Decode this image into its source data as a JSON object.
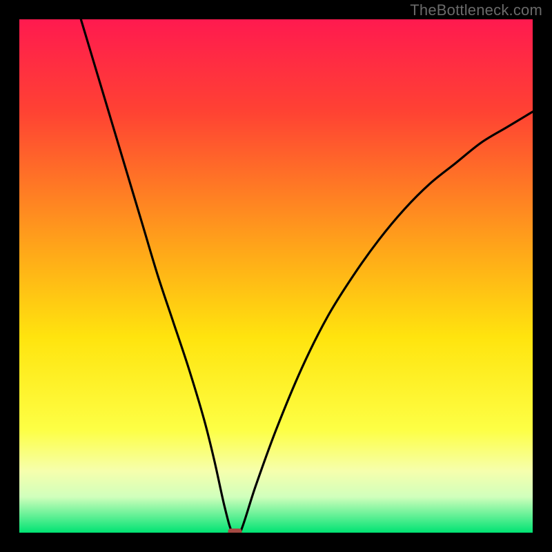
{
  "watermark": "TheBottleneck.com",
  "chart_data": {
    "type": "line",
    "title": "",
    "xlabel": "",
    "ylabel": "",
    "xlim": [
      0,
      100
    ],
    "ylim": [
      0,
      100
    ],
    "grid": false,
    "legend": false,
    "annotations": [],
    "marker": {
      "x": 42,
      "y": 0,
      "color": "#a54a43"
    },
    "gradient_stops": [
      {
        "offset": 0,
        "color": "#ff1a4f"
      },
      {
        "offset": 18,
        "color": "#ff4233"
      },
      {
        "offset": 45,
        "color": "#ffa719"
      },
      {
        "offset": 62,
        "color": "#ffe40e"
      },
      {
        "offset": 80,
        "color": "#fdff45"
      },
      {
        "offset": 88,
        "color": "#f6ffad"
      },
      {
        "offset": 93,
        "color": "#d1ffbc"
      },
      {
        "offset": 100,
        "color": "#00e373"
      }
    ],
    "series": [
      {
        "name": "curve",
        "x": [
          12,
          15,
          18,
          21,
          24,
          27,
          30,
          33,
          36,
          38,
          40,
          41.5,
          43,
          46,
          50,
          55,
          60,
          65,
          70,
          75,
          80,
          85,
          90,
          95,
          100
        ],
        "y": [
          100,
          90,
          80,
          70,
          60,
          50,
          41,
          32,
          22,
          14,
          5,
          0,
          0,
          9,
          20,
          32,
          42,
          50,
          57,
          63,
          68,
          72,
          76,
          79,
          82
        ]
      }
    ]
  }
}
